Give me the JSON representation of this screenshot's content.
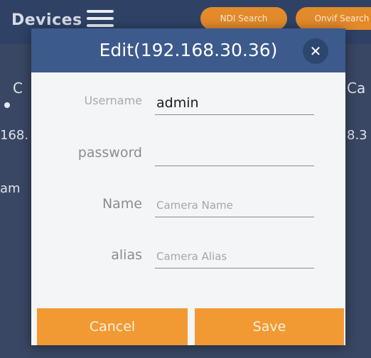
{
  "background": {
    "title": "Devices",
    "ndi_search_label": "NDI Search",
    "onvif_search_label": "Onvif Search",
    "fragments": {
      "left_c": "C",
      "right_ca": "Ca",
      "left_ip": "168.",
      "right_ip": "8.3",
      "left_am": "am"
    }
  },
  "dialog": {
    "title": "Edit(192.168.30.36)",
    "close_icon": "close-icon",
    "fields": {
      "username": {
        "label": "Username",
        "value": "admin",
        "placeholder": ""
      },
      "password": {
        "label": "password",
        "value": "",
        "placeholder": ""
      },
      "name": {
        "label": "Name",
        "value": "",
        "placeholder": "Camera Name"
      },
      "alias": {
        "label": "alias",
        "value": "",
        "placeholder": "Camera Alias"
      }
    },
    "cancel_label": "Cancel",
    "save_label": "Save"
  },
  "colors": {
    "header_blue": "#3d5a8c",
    "button_orange": "#f19a34",
    "background_blue": "#2f4266"
  }
}
